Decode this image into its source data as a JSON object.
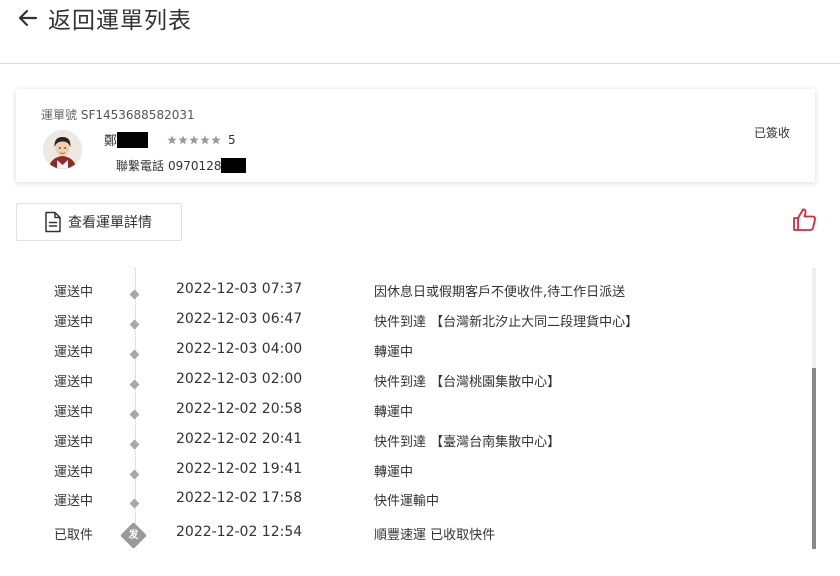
{
  "header": {
    "back_label": "返回運單列表"
  },
  "card": {
    "waybill_label": "運單號",
    "waybill_number": "SF1453688582031",
    "courier_name": "鄭",
    "rating_stars": 5,
    "rating": "5",
    "phone_label": "聯繫電話",
    "phone_number": "0970128",
    "status": "已簽收"
  },
  "actions": {
    "detail_label": "查看運單詳情"
  },
  "colors": {
    "thumb_accent": "#d9283d",
    "dot": "#a8a8a8"
  },
  "timeline": [
    {
      "status": "運送中",
      "time": "2022-12-03 07:37",
      "desc": "因休息日或假期客戶不便收件,待工作日派送"
    },
    {
      "status": "運送中",
      "time": "2022-12-03 06:47",
      "desc": "快件到達 【台灣新北汐止大同二段理貨中心】"
    },
    {
      "status": "運送中",
      "time": "2022-12-03 04:00",
      "desc": "轉運中"
    },
    {
      "status": "運送中",
      "time": "2022-12-03 02:00",
      "desc": "快件到達 【台灣桃園集散中心】"
    },
    {
      "status": "運送中",
      "time": "2022-12-02 20:58",
      "desc": "轉運中"
    },
    {
      "status": "運送中",
      "time": "2022-12-02 20:41",
      "desc": "快件到達 【臺灣台南集散中心】"
    },
    {
      "status": "運送中",
      "time": "2022-12-02 19:41",
      "desc": "轉運中"
    },
    {
      "status": "運送中",
      "time": "2022-12-02 17:58",
      "desc": "快件運輸中"
    },
    {
      "status": "已取件",
      "time": "2022-12-02 12:54",
      "desc": "順豐速運 已收取快件",
      "badge": "发"
    }
  ]
}
